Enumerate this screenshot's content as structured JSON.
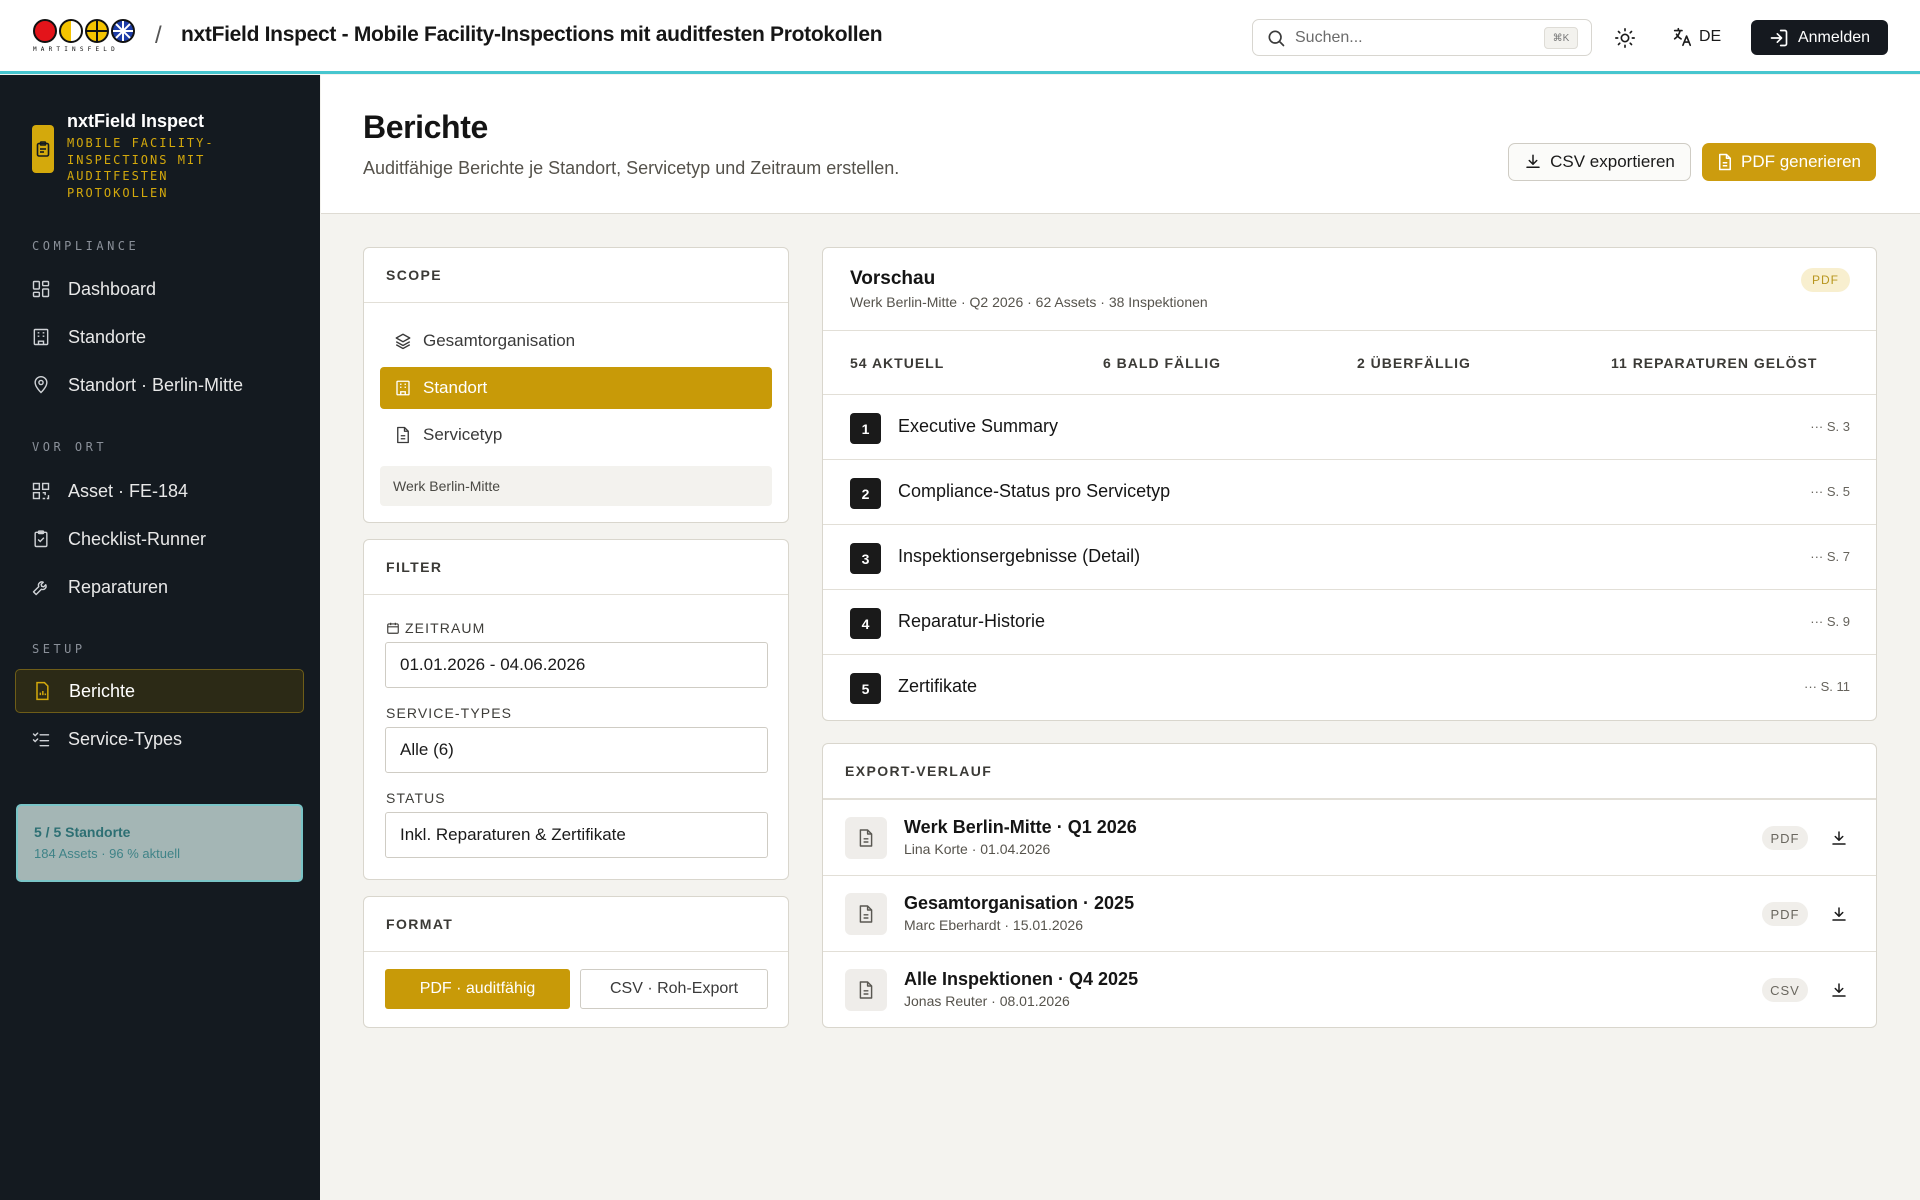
{
  "header": {
    "logo_text": "MARTINSFELD",
    "separator": "/",
    "app_title": "nxtField Inspect - Mobile Facility-Inspections mit auditfesten Protokollen",
    "search_placeholder": "Suchen...",
    "search_shortcut": "⌘K",
    "language": "DE",
    "login_label": "Anmelden",
    "accent_color": "#47c6cf"
  },
  "sidebar": {
    "brand_name": "nxtField Inspect",
    "brand_sub": "MOBILE FACILITY-INSPECTIONS MIT AUDITFESTEN PROTOKOLLEN",
    "sections": [
      {
        "label": "COMPLIANCE",
        "items": [
          {
            "label": "Dashboard",
            "icon": "dashboard-icon"
          },
          {
            "label": "Standorte",
            "icon": "building-icon"
          },
          {
            "label": "Standort · Berlin-Mitte",
            "icon": "map-pin-icon"
          }
        ]
      },
      {
        "label": "VOR ORT",
        "items": [
          {
            "label": "Asset · FE-184",
            "icon": "qr-code-icon"
          },
          {
            "label": "Checklist-Runner",
            "icon": "clipboard-check-icon"
          },
          {
            "label": "Reparaturen",
            "icon": "wrench-icon"
          }
        ]
      },
      {
        "label": "SETUP",
        "items": [
          {
            "label": "Berichte",
            "icon": "report-icon",
            "active": true
          },
          {
            "label": "Service-Types",
            "icon": "list-checks-icon"
          }
        ]
      }
    ],
    "summary": {
      "title": "5 / 5 Standorte",
      "subtitle": "184 Assets · 96 % aktuell"
    }
  },
  "page": {
    "title": "Berichte",
    "subtitle": "Auditfähige Berichte je Standort, Servicetyp und Zeitraum erstellen.",
    "csv_button": "CSV exportieren",
    "pdf_button": "PDF generieren",
    "brand_color": "#cc9c0e"
  },
  "scope": {
    "heading": "SCOPE",
    "options": [
      {
        "label": "Gesamtorganisation",
        "icon": "layers-icon"
      },
      {
        "label": "Standort",
        "icon": "building-icon",
        "active": true
      },
      {
        "label": "Servicetyp",
        "icon": "document-icon"
      }
    ],
    "selected_site": "Werk Berlin-Mitte"
  },
  "filter": {
    "heading": "FILTER",
    "period_label": "ZEITRAUM",
    "period_value": "01.01.2026 - 04.06.2026",
    "service_types_label": "SERVICE-TYPES",
    "service_types_value": "Alle (6)",
    "status_label": "STATUS",
    "status_value": "Inkl. Reparaturen & Zertifikate"
  },
  "format": {
    "heading": "FORMAT",
    "pdf_option": "PDF · auditfähig",
    "csv_option": "CSV · Roh-Export"
  },
  "preview": {
    "title": "Vorschau",
    "subtitle": "Werk Berlin-Mitte · Q2 2026 · 62 Assets · 38 Inspektionen",
    "badge": "PDF",
    "stats": [
      "54 AKTUELL",
      "6 BALD FÄLLIG",
      "2 ÜBERFÄLLIG",
      "11 REPARATUREN GELÖST"
    ],
    "toc": [
      {
        "num": "1",
        "label": "Executive Summary",
        "page": "··· S. 3"
      },
      {
        "num": "2",
        "label": "Compliance-Status pro Servicetyp",
        "page": "··· S. 5"
      },
      {
        "num": "3",
        "label": "Inspektionsergebnisse (Detail)",
        "page": "··· S. 7"
      },
      {
        "num": "4",
        "label": "Reparatur-Historie",
        "page": "··· S. 9"
      },
      {
        "num": "5",
        "label": "Zertifikate",
        "page": "··· S. 11"
      }
    ]
  },
  "exports": {
    "heading": "EXPORT-VERLAUF",
    "items": [
      {
        "title": "Werk Berlin-Mitte · Q1 2026",
        "meta": "Lina Korte · 01.04.2026",
        "format": "PDF"
      },
      {
        "title": "Gesamtorganisation · 2025",
        "meta": "Marc Eberhardt · 15.01.2026",
        "format": "PDF"
      },
      {
        "title": "Alle Inspektionen · Q4 2025",
        "meta": "Jonas Reuter · 08.01.2026",
        "format": "CSV"
      }
    ]
  }
}
